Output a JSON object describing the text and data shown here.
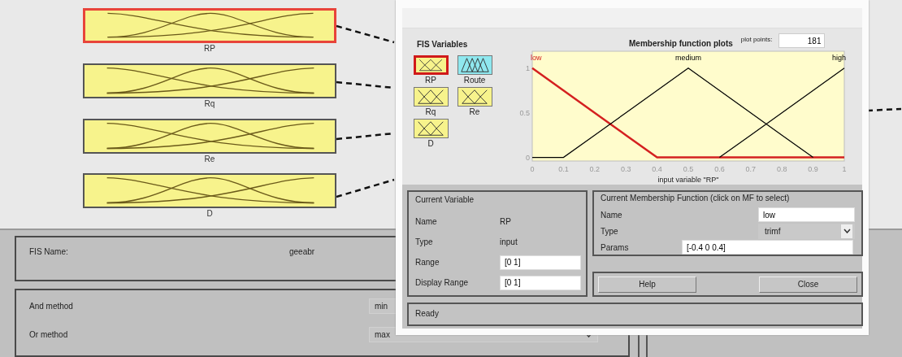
{
  "input_variables": [
    {
      "name": "RP",
      "selected": true
    },
    {
      "name": "Rq",
      "selected": false
    },
    {
      "name": "Re",
      "selected": false
    },
    {
      "name": "D",
      "selected": false
    }
  ],
  "fis_panel": {
    "label": "FIS Name:",
    "value": "geeabr"
  },
  "methods": [
    {
      "label": "And method",
      "value": "min"
    },
    {
      "label": "Or method",
      "value": "max"
    }
  ],
  "mf_editor": {
    "variables_title": "FIS Variables",
    "variables": [
      {
        "name": "RP",
        "kind": "input",
        "selected": true
      },
      {
        "name": "Route",
        "kind": "output",
        "selected": false
      },
      {
        "name": "Rq",
        "kind": "input",
        "selected": false
      },
      {
        "name": "Re",
        "kind": "input",
        "selected": false
      },
      {
        "name": "D",
        "kind": "input",
        "selected": false
      }
    ],
    "plot_title": "Membership function plots",
    "plot_points_label": "plot points:",
    "plot_points": "181",
    "chart_data": {
      "type": "line",
      "xlabel": "input variable \"RP\"",
      "x": [
        0,
        0.1,
        0.2,
        0.3,
        0.4,
        0.5,
        0.6,
        0.7,
        0.8,
        0.9,
        1
      ],
      "series": [
        {
          "name": "low",
          "color": "#d42020",
          "values": [
            1,
            0.75,
            0.5,
            0.25,
            0,
            0,
            0,
            0,
            0,
            0,
            0
          ]
        },
        {
          "name": "medium",
          "color": "#000000",
          "values": [
            0,
            0,
            0.25,
            0.5,
            0.75,
            1,
            0.75,
            0.5,
            0.25,
            0,
            null
          ]
        },
        {
          "name": "high",
          "color": "#000000",
          "values": [
            null,
            null,
            null,
            null,
            null,
            null,
            0,
            0.25,
            0.5,
            0.75,
            1
          ]
        }
      ],
      "xlim": [
        0,
        1
      ],
      "ylim": [
        -0.04,
        1.19
      ],
      "xticks": [
        0,
        0.1,
        0.2,
        0.3,
        0.4,
        0.5,
        0.6,
        0.7,
        0.8,
        0.9,
        1
      ],
      "yticks": [
        0,
        0.5,
        1
      ]
    },
    "current_variable": {
      "title": "Current Variable",
      "rows": [
        {
          "label": "Name",
          "value": "RP",
          "kind": "text"
        },
        {
          "label": "Type",
          "value": "input",
          "kind": "text"
        },
        {
          "label": "Range",
          "value": "[0 1]",
          "kind": "field"
        },
        {
          "label": "Display Range",
          "value": "[0 1]",
          "kind": "field"
        }
      ]
    },
    "current_mf": {
      "title": "Current Membership Function (click on MF to select)",
      "name_label": "Name",
      "name": "low",
      "type_label": "Type",
      "type": "trimf",
      "params_label": "Params",
      "params": "[-0.4 0 0.4]"
    },
    "buttons": [
      "Help",
      "Close"
    ],
    "status": "Ready"
  }
}
